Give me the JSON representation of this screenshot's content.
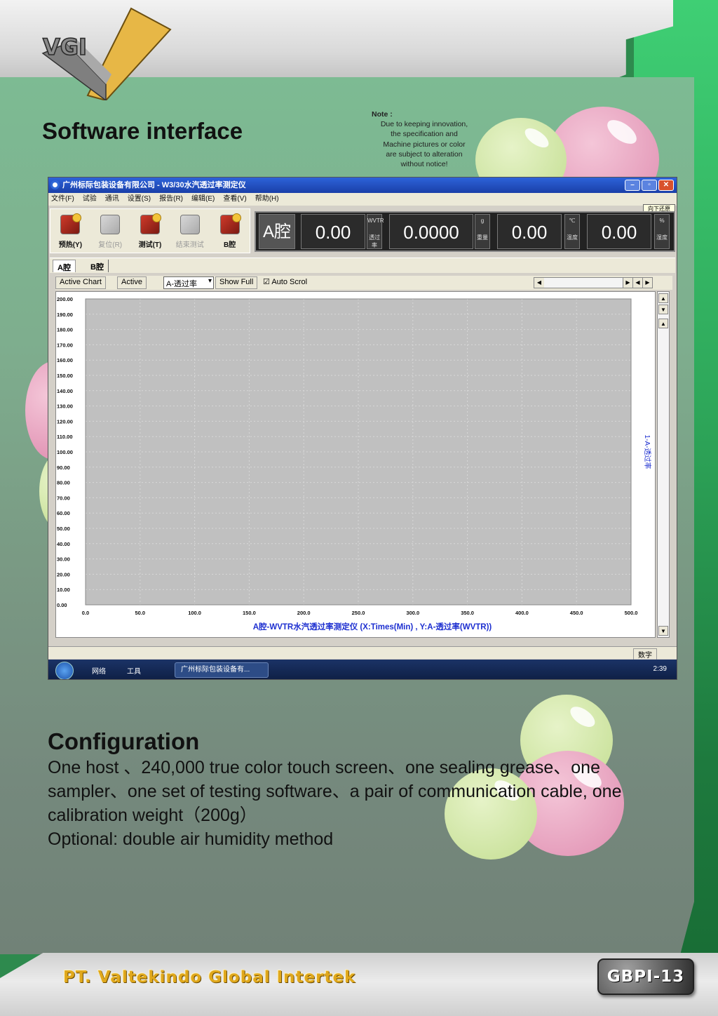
{
  "logo": {
    "text": "VGI"
  },
  "header": {
    "title": "Software interface",
    "note": {
      "label": "Note :",
      "lines": [
        "Due to keeping innovation,",
        "the specification and",
        "Machine pictures or color",
        "are subject to alteration",
        "without notice!"
      ]
    }
  },
  "software": {
    "window_title": "广州标际包装设备有限公司 - W3/30水汽透过率测定仪",
    "menu": [
      "文件(F)",
      "试验",
      "通讯",
      "设置(S)",
      "报告(R)",
      "编辑(E)",
      "查看(V)",
      "帮助(H)"
    ],
    "restore_label": "向下还原",
    "toolbar": [
      {
        "label": "预热(Y)",
        "enabled": true
      },
      {
        "label": "复位(R)",
        "enabled": false
      },
      {
        "label": "测试(T)",
        "enabled": true
      },
      {
        "label": "结束测试",
        "enabled": false
      },
      {
        "label": "B腔",
        "enabled": true
      }
    ],
    "chamber_label": "A腔",
    "readouts": [
      {
        "value": "0.00",
        "unit_top": "WVTR",
        "unit_bottom": "透过率"
      },
      {
        "value": "0.0000",
        "unit_top": "g",
        "unit_bottom": "重量"
      },
      {
        "value": "0.00",
        "unit_top": "℃",
        "unit_bottom": "温度"
      },
      {
        "value": "0.00",
        "unit_top": "%",
        "unit_bottom": "湿度"
      }
    ],
    "tabs": [
      "A腔",
      "B腔"
    ],
    "controls": {
      "active_chart": "Active Chart",
      "active": "Active",
      "series_select": "A-透过率",
      "show_full": "Show Full",
      "auto_scroll": "Auto Scrol"
    },
    "status_right": "数字",
    "taskbar": {
      "items": [
        "网络",
        "工具"
      ],
      "active_task": "广州标际包装设备有...",
      "clock": "2:39"
    }
  },
  "chart_data": {
    "type": "line",
    "title": "A腔-WVTR水汽透过率测定仪 (X:Times(Min) , Y:A-透过率(WVTR))",
    "xlabel": "",
    "ylabel": "",
    "right_label": "1-A-透过率",
    "xlim": [
      0,
      500
    ],
    "ylim": [
      0,
      200
    ],
    "x_ticks": [
      "0.0",
      "50.0",
      "100.0",
      "150.0",
      "200.0",
      "250.0",
      "300.0",
      "350.0",
      "400.0",
      "450.0",
      "500.0"
    ],
    "y_ticks": [
      "0.00",
      "10.00",
      "20.00",
      "30.00",
      "40.00",
      "50.00",
      "60.00",
      "70.00",
      "80.00",
      "90.00",
      "100.00",
      "110.00",
      "120.00",
      "130.00",
      "140.00",
      "150.00",
      "160.00",
      "170.00",
      "180.00",
      "190.00",
      "200.00"
    ],
    "grid": true,
    "series": [],
    "colors": {
      "plot_bg": "#c0c0c0",
      "title": "#1d2fd0"
    }
  },
  "configuration": {
    "title": "Configuration",
    "lines": [
      "One host 、240,000 true color touch screen、one sealing grease、one",
      "sampler、one set of testing software、a pair of communication cable, one",
      "calibration weight（200g）",
      "Optional: double air humidity method"
    ]
  },
  "footer": {
    "company": "PT. Valtekindo Global Intertek",
    "page_code": "GBPI-13"
  }
}
